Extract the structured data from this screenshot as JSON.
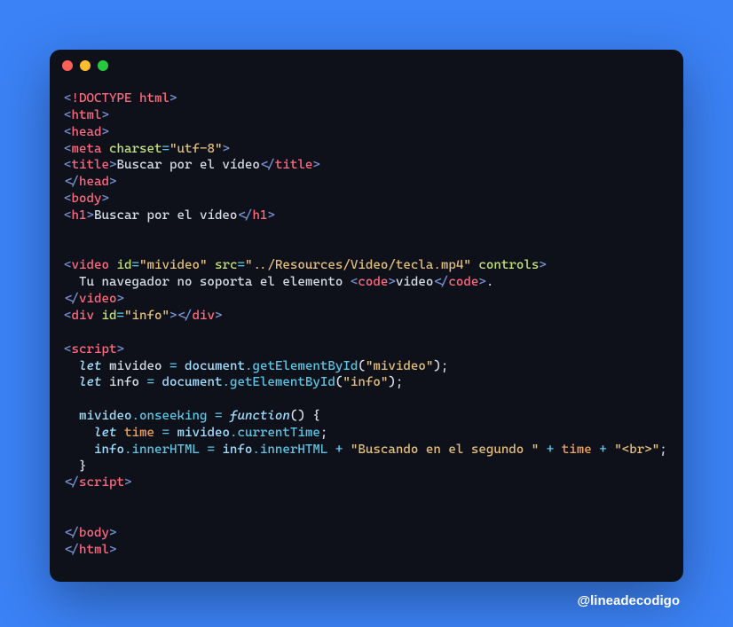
{
  "credit": "@lineadecodigo",
  "code_lines": {
    "l1": {
      "doctype": "!DOCTYPE html"
    },
    "l2": {
      "tag": "html"
    },
    "l3": {
      "tag": "head"
    },
    "l4": {
      "tag": "meta",
      "attr": "charset",
      "val": "\"utf-8\""
    },
    "l5": {
      "tag": "title",
      "text": "Buscar por el vídeo",
      "close": "title"
    },
    "l6": {
      "close": "head"
    },
    "l7": {
      "tag": "body"
    },
    "l8": {
      "tag": "h1",
      "text": "Buscar por el vídeo",
      "close": "h1"
    },
    "l11": {
      "tag": "video",
      "attr1": "id",
      "val1": "\"mivideo\"",
      "attr2": "src",
      "val2": "\"../Resources/Video/tecla.mp4\"",
      "attr3": "controls"
    },
    "l12": {
      "text1": "  Tu navegador no soporta el elemento ",
      "tag": "code",
      "text2": "video",
      "close": "code",
      "dot": "."
    },
    "l13": {
      "close": "video"
    },
    "l14": {
      "tag": "div",
      "attr": "id",
      "val": "\"info\"",
      "close": "div"
    },
    "l16": {
      "tag": "script"
    },
    "l17": {
      "kw": "let",
      "n": "mivideo",
      "d": "document",
      "m": "getElementById",
      "a": "\"mivideo\""
    },
    "l18": {
      "kw": "let",
      "n": "info",
      "d": "document",
      "m": "getElementById",
      "a": "\"info\""
    },
    "l20": {
      "o": "mivideo",
      "p": "onseeking",
      "fn": "function"
    },
    "l21": {
      "kw": "let",
      "n": "time",
      "o": "mivideo",
      "p": "currentTime"
    },
    "l22": {
      "o1": "info",
      "p1": "innerHTML",
      "o2": "info",
      "p2": "innerHTML",
      "s1": "\"Buscando en el segundo \"",
      "v": "time",
      "s2": "\"<br>\""
    },
    "l23": {
      "brace": "  }"
    },
    "l24": {
      "close": "script"
    },
    "l27": {
      "close": "body"
    },
    "l28": {
      "close": "html"
    }
  }
}
